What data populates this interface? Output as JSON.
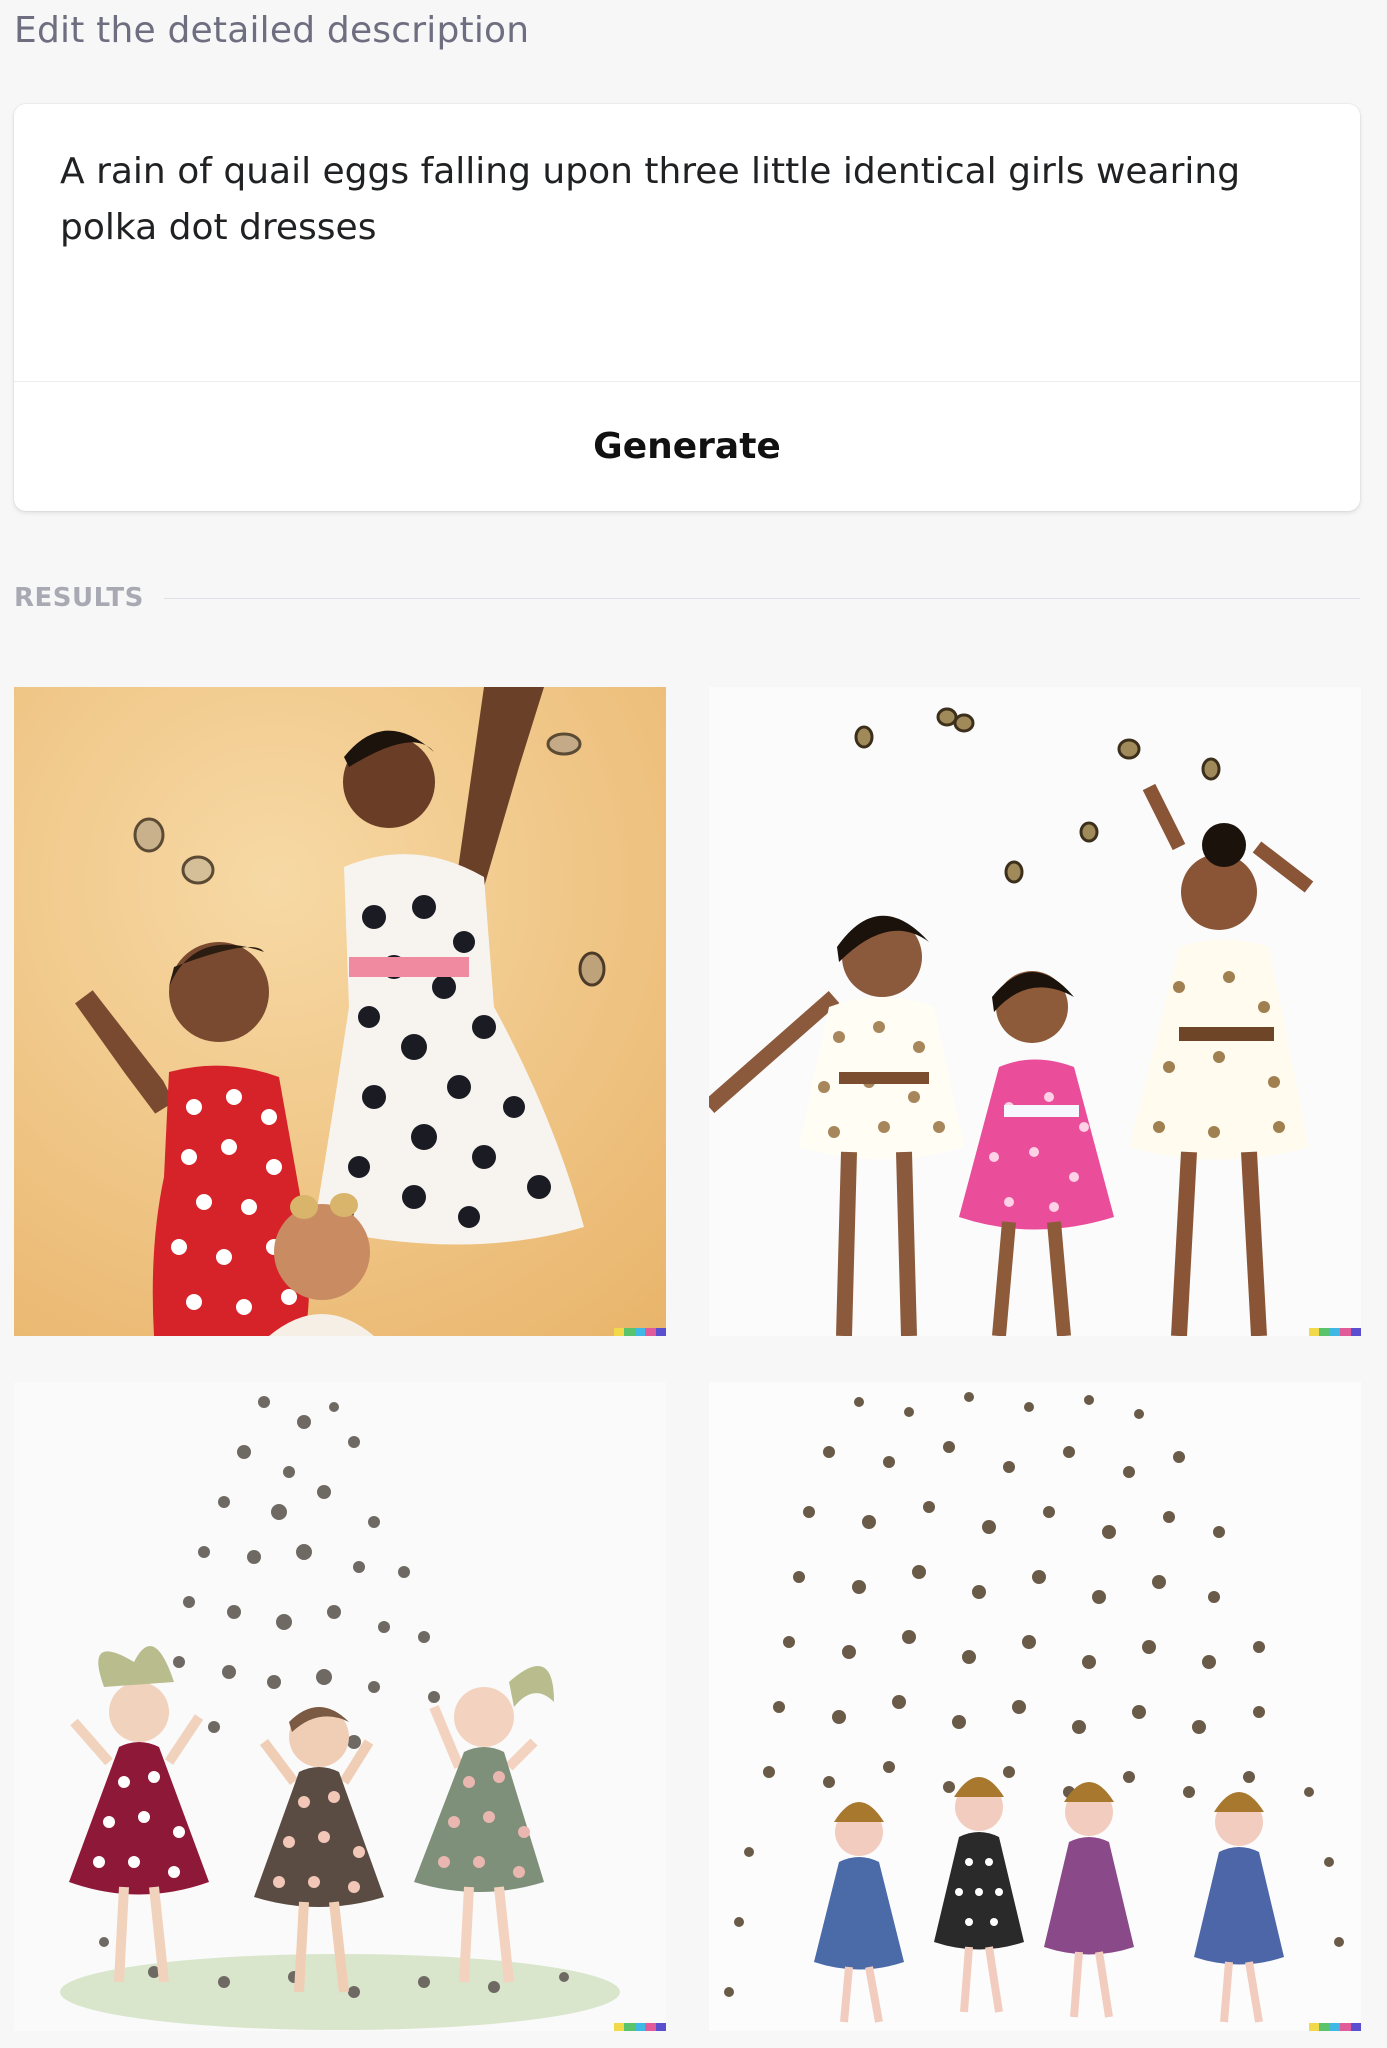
{
  "header": {
    "title": "Edit the detailed description"
  },
  "prompt": {
    "text": "A rain of quail eggs falling upon three little identical girls wearing\npolka dot dresses"
  },
  "actions": {
    "generate_label": "Generate"
  },
  "results": {
    "label": "RESULTS",
    "images": [
      {
        "name": "result-image-1",
        "background": "#f2c98a"
      },
      {
        "name": "result-image-2",
        "background": "#fbfbfb"
      },
      {
        "name": "result-image-3",
        "background": "#fafafa"
      },
      {
        "name": "result-image-4",
        "background": "#fcfcfc"
      }
    ],
    "signature_colors": [
      "#f2d94a",
      "#59c46c",
      "#3fb8e6",
      "#e15b9a",
      "#5a4fcf"
    ]
  }
}
